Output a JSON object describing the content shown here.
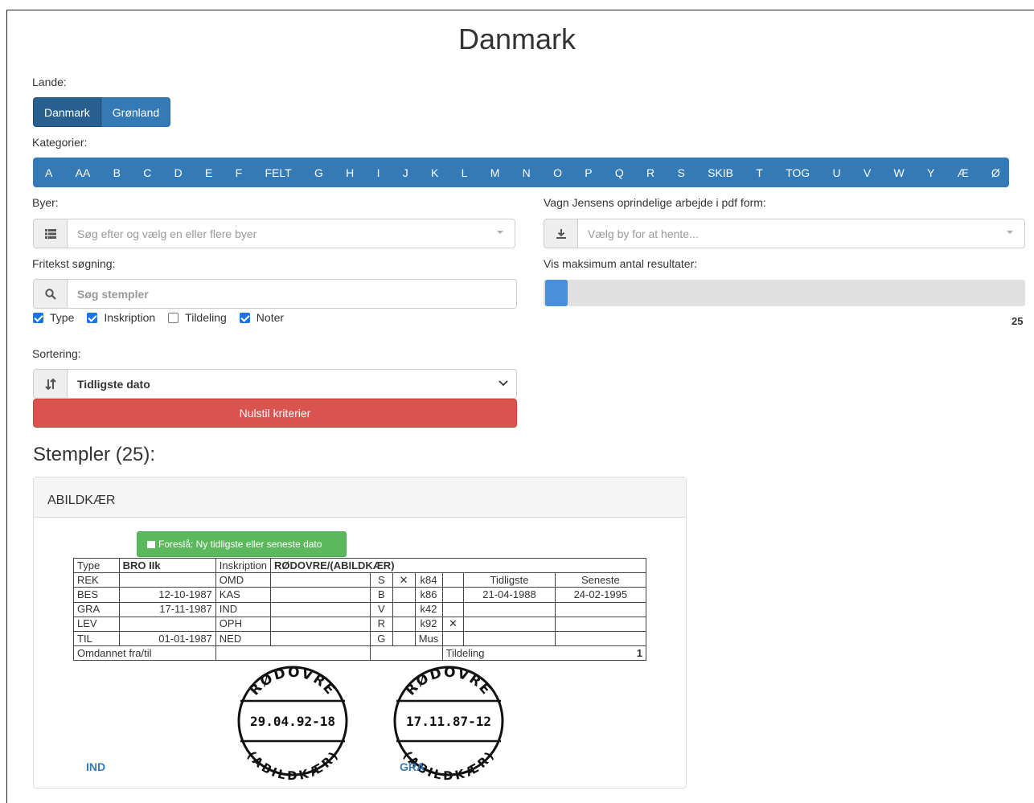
{
  "page": {
    "title": "Danmark"
  },
  "labels": {
    "lande": "Lande:",
    "kategorier": "Kategorier:",
    "byer": "Byer:",
    "pdf": "Vagn Jensens oprindelige arbejde i pdf form:",
    "fritekst": "Fritekst søgning:",
    "vis_max": "Vis maksimum antal resultater:",
    "sortering": "Sortering:"
  },
  "countries": [
    "Danmark",
    "Grønland"
  ],
  "active_country": "Danmark",
  "categories": [
    "A",
    "AA",
    "B",
    "C",
    "D",
    "E",
    "F",
    "FELT",
    "G",
    "H",
    "I",
    "J",
    "K",
    "L",
    "M",
    "N",
    "O",
    "P",
    "Q",
    "R",
    "S",
    "SKIB",
    "T",
    "TOG",
    "U",
    "V",
    "W",
    "Y",
    "Æ",
    "Ø"
  ],
  "byer_select": {
    "placeholder": "Søg efter og vælg en eller flere byer"
  },
  "pdf_select": {
    "placeholder": "Vælg by for at hente..."
  },
  "search": {
    "placeholder": "Søg stempler",
    "value": ""
  },
  "checkboxes": [
    {
      "label": "Type",
      "checked": true
    },
    {
      "label": "Inskription",
      "checked": true
    },
    {
      "label": "Tildeling",
      "checked": false
    },
    {
      "label": "Noter",
      "checked": true
    }
  ],
  "slider": {
    "value": "25",
    "fraction": 0.05
  },
  "sort": {
    "value": "Tidligste dato"
  },
  "reset_label": "Nulstil kriterier",
  "results_title": "Stempler (25):",
  "panel": {
    "title": "ABILDKÆR",
    "suggest_label": "Foreslå: Ny tidligste eller seneste dato",
    "table": {
      "type_label": "Type",
      "type_value": "BRO IIk",
      "inscription_label": "Inskription",
      "inscription_value": "RØDOVRE/(ABILDKÆR)",
      "rows": [
        {
          "a": "REK",
          "b": "",
          "c": "OMD",
          "d": "",
          "e": "S",
          "f": "✕",
          "g": "k84",
          "h": "",
          "i": "Tidligste",
          "j": "Seneste"
        },
        {
          "a": "BES",
          "b": "12-10-1987",
          "c": "KAS",
          "d": "",
          "e": "B",
          "f": "",
          "g": "k86",
          "h": "",
          "i": "21-04-1988",
          "j": "24-02-1995"
        },
        {
          "a": "GRA",
          "b": "17-11-1987",
          "c": "IND",
          "d": "",
          "e": "V",
          "f": "",
          "g": "k42",
          "h": "",
          "i": "",
          "j": ""
        },
        {
          "a": "LEV",
          "b": "",
          "c": "OPH",
          "d": "",
          "e": "R",
          "f": "",
          "g": "k92",
          "h": "✕",
          "i": "",
          "j": ""
        },
        {
          "a": "TIL",
          "b": "01-01-1987",
          "c": "NED",
          "d": "",
          "e": "G",
          "f": "",
          "g": "Mus",
          "h": "",
          "i": "",
          "j": ""
        }
      ],
      "omdannet_label": "Omdannet fra/til",
      "tildeling_label": "Tildeling",
      "tildeling_value": "1"
    },
    "stamps": [
      {
        "top": "RØDOVRE",
        "date": "29.04.92-18",
        "bottom": "(ABILDKÆR)",
        "caption": "IND"
      },
      {
        "top": "RØDOVRE",
        "date": "17.11.87-12",
        "bottom": "(ABILDKÆR)",
        "caption": "GRA"
      }
    ]
  }
}
